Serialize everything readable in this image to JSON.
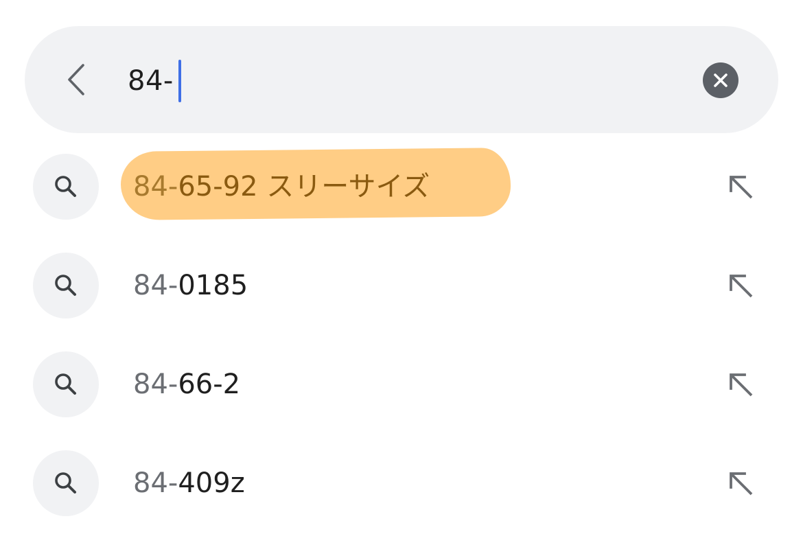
{
  "search": {
    "query": "84-",
    "back_icon": "chevron-left-icon",
    "clear_icon": "clear-x-icon"
  },
  "suggestions": [
    {
      "prefix": "84-",
      "rest": "65-92 スリーサイズ",
      "icon": "search-icon",
      "action_icon": "arrow-up-left-icon",
      "highlighted": true
    },
    {
      "prefix": "84-",
      "rest": "0185",
      "icon": "search-icon",
      "action_icon": "arrow-up-left-icon",
      "highlighted": false
    },
    {
      "prefix": "84-",
      "rest": "66-2",
      "icon": "search-icon",
      "action_icon": "arrow-up-left-icon",
      "highlighted": false
    },
    {
      "prefix": "84-",
      "rest": "409z",
      "icon": "search-icon",
      "action_icon": "arrow-up-left-icon",
      "highlighted": false
    }
  ],
  "colors": {
    "bar_background": "#f1f2f4",
    "caret": "#3f6fe6",
    "highlighter": "#ffca7e",
    "clear_button": "#5c6066"
  }
}
